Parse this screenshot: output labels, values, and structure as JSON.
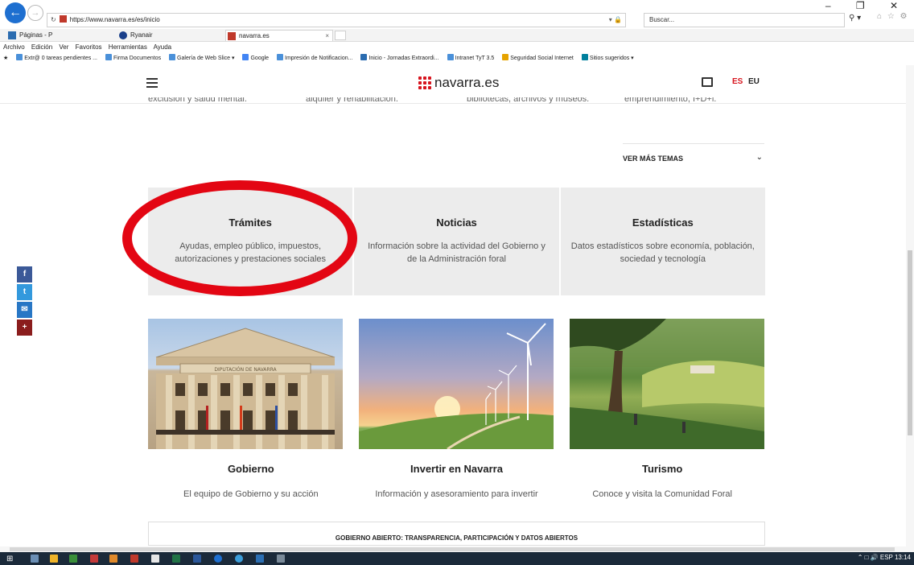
{
  "browser": {
    "url": "https://www.navarra.es/es/inicio",
    "search_placeholder": "Buscar...",
    "tabs": [
      "Páginas - P",
      "Ryanair",
      "navarra.es"
    ],
    "menu": [
      "Archivo",
      "Edición",
      "Ver",
      "Favoritos",
      "Herramientas",
      "Ayuda"
    ],
    "bookmarks": [
      "Extr@ 0 tareas pendientes ...",
      "Firma Documentos",
      "Galería de Web Slice ▾",
      "Google",
      "Impresión de Notificacion...",
      "Inicio - Jornadas Extraordi...",
      "Intranet TyT 3.5",
      "Seguridad Social Internet",
      "Sitios sugeridos ▾"
    ]
  },
  "site": {
    "logo": "navarra.es",
    "lang_es": "ES",
    "lang_eu": "EU"
  },
  "cut_topics": [
    "exclusión y salud mental.",
    "alquiler y rehabilitación.",
    "bibliotecas, archivos y museos.",
    "emprendimiento, I+D+i."
  ],
  "more_topics": "VER MÁS TEMAS",
  "cards": [
    {
      "title": "Trámites",
      "desc": "Ayudas, empleo público, impuestos, autorizaciones y prestaciones sociales"
    },
    {
      "title": "Noticias",
      "desc": "Información sobre la actividad del Gobierno y de la Administración foral"
    },
    {
      "title": "Estadísticas",
      "desc": "Datos estadísticos sobre economía, población, sociedad y tecnología"
    }
  ],
  "photo_captions": [
    {
      "title": "Gobierno",
      "desc": "El equipo de Gobierno y su acción"
    },
    {
      "title": "Invertir en Navarra",
      "desc": "Información y asesoramiento para invertir"
    },
    {
      "title": "Turismo",
      "desc": "Conoce y visita la Comunidad Foral"
    }
  ],
  "photo_sign": "DIPUTACIÓN DE NAVARRA",
  "open_government": "GOBIERNO ABIERTO: TRANSPARENCIA, PARTICIPACIÓN Y DATOS ABIERTOS",
  "share": {
    "facebook": "f",
    "twitter": "t",
    "email": "✉",
    "more": "+"
  },
  "taskbar": {
    "lang": "ESP",
    "time": "13:14"
  }
}
